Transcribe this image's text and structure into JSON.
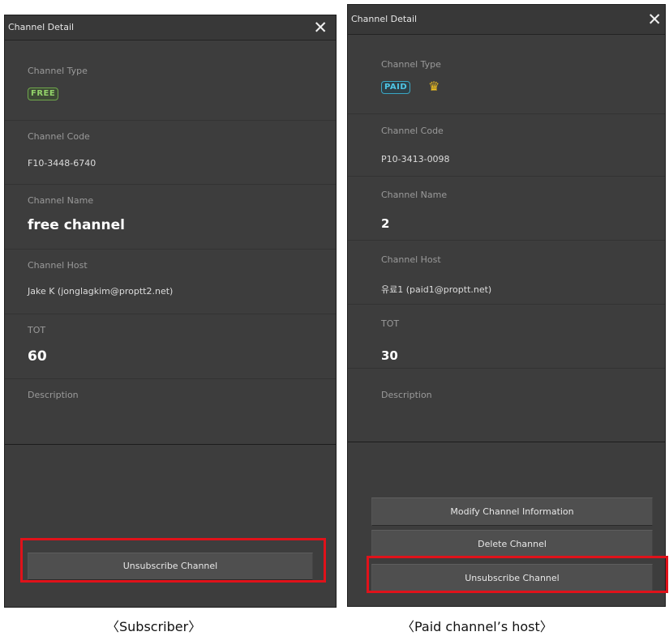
{
  "left": {
    "title": "Channel Detail",
    "fields": {
      "type_label": "Channel Type",
      "type_badge": "FREE",
      "code_label": "Channel Code",
      "code_value": "F10-3448-6740",
      "name_label": "Channel Name",
      "name_value": "free channel",
      "host_label": "Channel Host",
      "host_value": "Jake K (jonglagkim@proptt2.net)",
      "tot_label": "TOT",
      "tot_value": "60",
      "desc_label": "Description"
    },
    "buttons": {
      "unsubscribe": "Unsubscribe Channel"
    },
    "caption": "〈Subscriber〉"
  },
  "right": {
    "title": "Channel Detail",
    "fields": {
      "type_label": "Channel Type",
      "type_badge": "PAID",
      "code_label": "Channel Code",
      "code_value": "P10-3413-0098",
      "name_label": "Channel Name",
      "name_value": "2",
      "host_label": "Channel Host",
      "host_value": "유료1 (paid1@proptt.net)",
      "tot_label": "TOT",
      "tot_value": "30",
      "desc_label": "Description"
    },
    "buttons": {
      "modify": "Modify Channel Information",
      "delete": "Delete Channel",
      "unsubscribe": "Unsubscribe Channel"
    },
    "caption": "〈Paid channel’s host〉"
  },
  "icons": {
    "close": "close-icon",
    "crown": "crown-icon"
  },
  "colors": {
    "highlight": "#e0121a",
    "free_badge": "#93d36a",
    "paid_badge": "#4fc6e6",
    "crown": "#f0c020"
  }
}
